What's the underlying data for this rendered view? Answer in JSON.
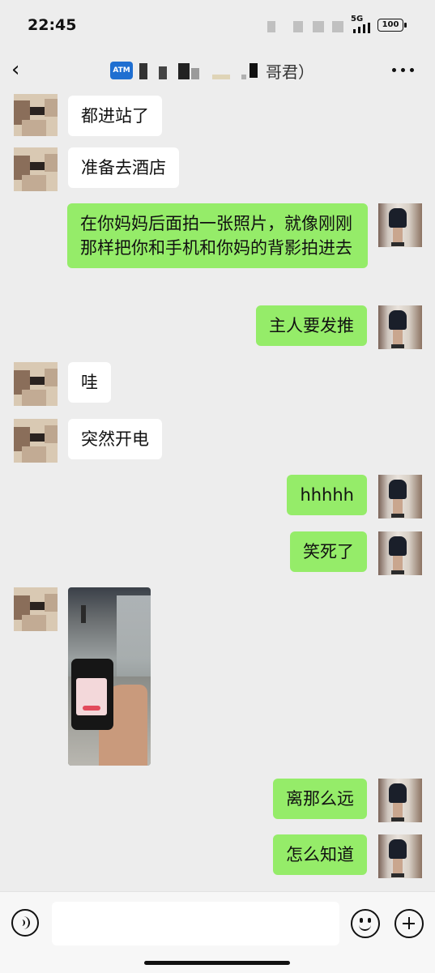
{
  "status_bar": {
    "time": "22:45",
    "network": "5G",
    "battery": "100"
  },
  "nav": {
    "badge": "ATM",
    "title_visible_suffix": "哥君）",
    "back_icon": "chevron-left-icon",
    "more_icon": "more-dots-icon"
  },
  "messages": [
    {
      "side": "left",
      "text": "都进站了"
    },
    {
      "side": "left",
      "text": "准备去酒店"
    },
    {
      "side": "right",
      "text": "在你妈妈后面拍一张照片，就像刚刚那样把你和手机和你妈的背影拍进去"
    },
    {
      "side": "right",
      "text": "主人要发推"
    },
    {
      "side": "left",
      "text": "哇"
    },
    {
      "side": "left",
      "text": "突然开电"
    },
    {
      "side": "right",
      "text": "hhhhh"
    },
    {
      "side": "right",
      "text": "笑死了"
    },
    {
      "side": "left",
      "type": "image",
      "description": "photo"
    },
    {
      "side": "right",
      "text": "离那么远"
    },
    {
      "side": "right",
      "text": "怎么知道"
    }
  ],
  "input_bar": {
    "value": "",
    "voice_icon": "voice-icon",
    "emoji_icon": "emoji-icon",
    "plus_icon": "plus-icon"
  },
  "colors": {
    "background": "#ededed",
    "bubble_right": "#95ec69",
    "bubble_left": "#ffffff",
    "atm_badge": "#1f6fd1"
  }
}
